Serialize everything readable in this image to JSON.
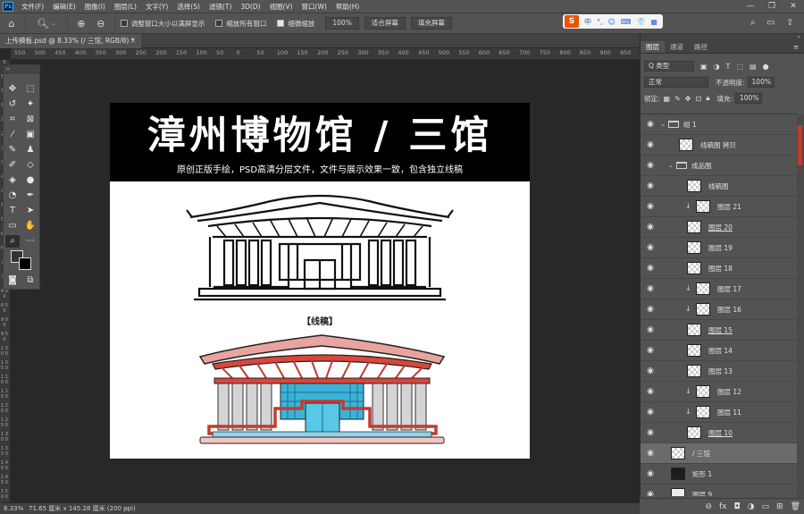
{
  "menubar": {
    "logo": "Ps",
    "items": [
      "文件(F)",
      "编辑(E)",
      "图像(I)",
      "图层(L)",
      "文字(Y)",
      "选择(S)",
      "滤镜(T)",
      "3D(D)",
      "视图(V)",
      "窗口(W)",
      "帮助(H)"
    ],
    "minimize": "—",
    "restore": "❐",
    "close": "✕"
  },
  "options": {
    "resize_windows": "调整窗口大小以满屏显示",
    "zoom_all": "缩放所有窗口",
    "scrubby_zoom": "细微缩放",
    "zoom_value": "100%",
    "fit_screen": "适合屏幕",
    "fill_screen": "填充屏幕"
  },
  "ime": {
    "logo": "S",
    "items": [
      "中",
      "°,",
      "☺",
      "⌨",
      "👕",
      "▦"
    ]
  },
  "doc_tab": {
    "title": "上传模板.psd @ 8.33% (/ 三馆, RGB/8) *",
    "close": "×"
  },
  "ruler_top": [
    "550",
    "500",
    "450",
    "400",
    "350",
    "300",
    "250",
    "200",
    "150",
    "100",
    "50",
    "0",
    "50",
    "100",
    "150",
    "200",
    "250",
    "300",
    "350",
    "400",
    "450",
    "500",
    "550",
    "600",
    "650",
    "700",
    "750",
    "800",
    "850",
    "900",
    "950"
  ],
  "ruler_left": [
    "0",
    "5 0",
    "1 0 0",
    "1 5 0",
    "2 0 0",
    "2 5 0",
    "3 0 0",
    "3 5 0",
    "4 0 0",
    "4 5 0",
    "5 0 0",
    "5 5 0",
    "6 0 0",
    "6 5 0",
    "7 0 0",
    "7 5 0",
    "8 0 0",
    "8 5 0",
    "9 0 0",
    "9 5 0",
    "1 0 0 0",
    "1 0 5 0",
    "1 1 0 0",
    "1 1 5 0",
    "1 2 0 0",
    "1 2 5 0",
    "1 3 0 0",
    "1 3 5 0",
    "1 4 0 0",
    "1 4 5 0",
    "1 5 0 0"
  ],
  "artwork": {
    "title": "漳州博物馆 / 三馆",
    "subtitle": "原创正版手绘，PSD高清分层文件，文件与展示效果一致，包含独立线稿",
    "caption": "【线稿】"
  },
  "status": {
    "zoom": "8.33%",
    "doc_size": "71.65 厘米 x 145.28 厘米 (200 ppi)",
    "arrow": "›"
  },
  "panel": {
    "tabs": [
      "图层",
      "通道",
      "路径"
    ],
    "filter_kind": "Q 类型",
    "blend_mode": "正常",
    "opacity_label": "不透明度:",
    "opacity_value": "100%",
    "lock_label": "锁定:",
    "fill_label": "填充:",
    "fill_value": "100%",
    "layers": [
      {
        "name": "组 1",
        "type": "folder",
        "indent": 0,
        "twirl": "⌄"
      },
      {
        "name": "线稿图 拷贝",
        "type": "pixel",
        "indent": 1
      },
      {
        "name": "成品图",
        "type": "folder",
        "indent": 1,
        "twirl": "⌄"
      },
      {
        "name": "线稿图",
        "type": "pixel",
        "indent": 2
      },
      {
        "name": "图层 21",
        "type": "pixel",
        "indent": 2,
        "clip": true
      },
      {
        "name": "图层 20",
        "type": "pixel",
        "indent": 2,
        "underline": true
      },
      {
        "name": "图层 19",
        "type": "pixel",
        "indent": 2
      },
      {
        "name": "图层 18",
        "type": "pixel",
        "indent": 2
      },
      {
        "name": "图层 17",
        "type": "pixel",
        "indent": 2,
        "clip": true
      },
      {
        "name": "图层 16",
        "type": "pixel",
        "indent": 2,
        "clip": true
      },
      {
        "name": "图层 15",
        "type": "pixel",
        "indent": 2,
        "underline": true
      },
      {
        "name": "图层 14",
        "type": "pixel",
        "indent": 2
      },
      {
        "name": "图层 13",
        "type": "pixel",
        "indent": 2
      },
      {
        "name": "图层 12",
        "type": "pixel",
        "indent": 2,
        "clip": true
      },
      {
        "name": "图层 11",
        "type": "pixel",
        "indent": 2,
        "clip": true
      },
      {
        "name": "图层 10",
        "type": "pixel",
        "indent": 2,
        "underline": true
      },
      {
        "name": "/ 三馆",
        "type": "text",
        "indent": 0,
        "active": true
      },
      {
        "name": "矩形 1",
        "type": "shape",
        "indent": 0
      },
      {
        "name": "图层 9",
        "type": "white",
        "indent": 0
      }
    ],
    "footer": [
      "⊖",
      "fx",
      "◘",
      "◑",
      "▭",
      "⊞",
      "🗑"
    ]
  }
}
